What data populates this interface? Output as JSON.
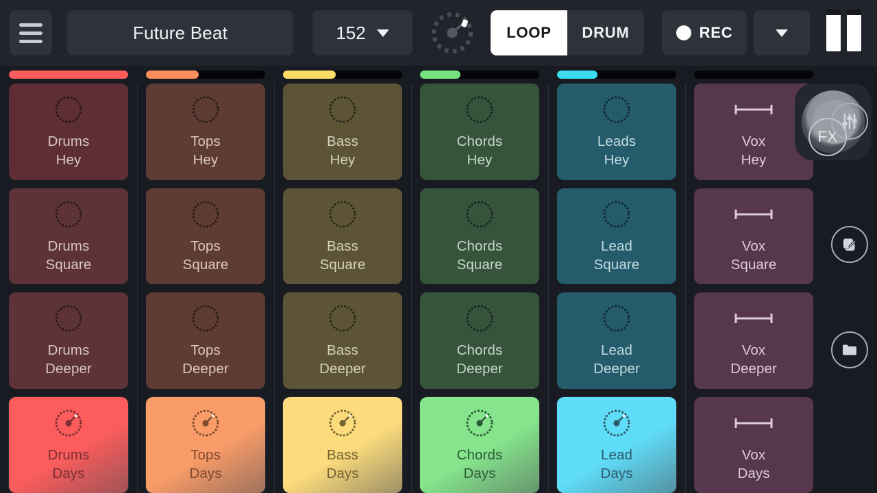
{
  "header": {
    "menu_icon": "hamburger-menu-icon",
    "project_name": "Future Beat",
    "tempo": "152",
    "tempo_caret_icon": "chevron-down-icon",
    "metronome_icon": "metronome-dial-icon",
    "mode_loop": "LOOP",
    "mode_drum": "DRUM",
    "active_mode": "LOOP",
    "rec_label": "REC",
    "rec_dot_icon": "record-dot-icon",
    "rec_options_caret_icon": "chevron-down-icon",
    "transport_icon": "pause-icon"
  },
  "colors": {
    "app_background": "#191b22",
    "header_background": "#22242c",
    "button_background": "#2f323b",
    "text_primary": "#f0f1f3",
    "accent_white": "#ffffff",
    "divider": "#2c2f38",
    "track_empty": "#050507"
  },
  "tracks": [
    {
      "name": "Drums",
      "color": "#fc5c5c",
      "progress_percent": 100
    },
    {
      "name": "Tops",
      "color": "#fa8f5e",
      "progress_percent": 44
    },
    {
      "name": "Bass",
      "color": "#fbdb64",
      "progress_percent": 44
    },
    {
      "name": "Chords",
      "color": "#74e281",
      "progress_percent": 34
    },
    {
      "name": "Leads",
      "color": "#3ddbf0",
      "progress_percent": 34
    },
    {
      "name": "Vox",
      "color": "#b77ab0",
      "progress_percent": 0
    }
  ],
  "grid": {
    "columns": [
      {
        "track": "Drums",
        "cells": [
          {
            "track_label": "Drums",
            "clip_label": "Hey",
            "state": "idle",
            "icon": "loop-circle-icon",
            "bg": "#5d2f34",
            "text": "#d8c5c5"
          },
          {
            "track_label": "Drums",
            "clip_label": "Square",
            "state": "idle",
            "icon": "loop-circle-icon",
            "bg": "#5d3338",
            "text": "#d8c5c5"
          },
          {
            "track_label": "Drums",
            "clip_label": "Deeper",
            "state": "idle",
            "icon": "loop-circle-icon",
            "bg": "#5d3338",
            "text": "#d8c5c5"
          },
          {
            "track_label": "Drums",
            "clip_label": "Days",
            "state": "playing",
            "icon": "playhead-dial-icon",
            "bg": "#fc5c5c",
            "text": "#7b2f34"
          }
        ]
      },
      {
        "track": "Tops",
        "cells": [
          {
            "track_label": "Tops",
            "clip_label": "Hey",
            "state": "idle",
            "icon": "loop-circle-icon",
            "bg": "#5f3c33",
            "text": "#dbc8bf"
          },
          {
            "track_label": "Tops",
            "clip_label": "Square",
            "state": "idle",
            "icon": "loop-circle-icon",
            "bg": "#5f3c33",
            "text": "#dbc8bf"
          },
          {
            "track_label": "Tops",
            "clip_label": "Deeper",
            "state": "idle",
            "icon": "loop-circle-icon",
            "bg": "#5f3c33",
            "text": "#dbc8bf"
          },
          {
            "track_label": "Tops",
            "clip_label": "Days",
            "state": "playing",
            "icon": "playhead-dial-icon",
            "bg": "#fa9c68",
            "text": "#7b4a30"
          }
        ]
      },
      {
        "track": "Bass",
        "cells": [
          {
            "track_label": "Bass",
            "clip_label": "Hey",
            "state": "idle",
            "icon": "loop-circle-icon",
            "bg": "#5d5435",
            "text": "#d6d2bd"
          },
          {
            "track_label": "Bass",
            "clip_label": "Square",
            "state": "idle",
            "icon": "loop-circle-icon",
            "bg": "#5d5435",
            "text": "#d6d2bd"
          },
          {
            "track_label": "Bass",
            "clip_label": "Deeper",
            "state": "idle",
            "icon": "loop-circle-icon",
            "bg": "#5d5435",
            "text": "#d6d2bd"
          },
          {
            "track_label": "Bass",
            "clip_label": "Days",
            "state": "playing",
            "icon": "playhead-dial-icon",
            "bg": "#fbdb7c",
            "text": "#746233"
          }
        ]
      },
      {
        "track": "Chords",
        "cells": [
          {
            "track_label": "Chords",
            "clip_label": "Hey",
            "state": "idle",
            "icon": "loop-circle-icon",
            "bg": "#36543c",
            "text": "#c6d6c7"
          },
          {
            "track_label": "Chords",
            "clip_label": "Square",
            "state": "idle",
            "icon": "loop-circle-icon",
            "bg": "#36543c",
            "text": "#c6d6c7"
          },
          {
            "track_label": "Chords",
            "clip_label": "Deeper",
            "state": "idle",
            "icon": "loop-circle-icon",
            "bg": "#36543c",
            "text": "#c6d6c7"
          },
          {
            "track_label": "Chords",
            "clip_label": "Days",
            "state": "playing",
            "icon": "playhead-dial-icon",
            "bg": "#85e48c",
            "text": "#2f5c38"
          }
        ]
      },
      {
        "track": "Leads",
        "cells": [
          {
            "track_label": "Leads",
            "clip_label": "Hey",
            "state": "idle",
            "icon": "loop-circle-icon",
            "bg": "#255c6b",
            "text": "#c3dbe2"
          },
          {
            "track_label": "Lead",
            "clip_label": "Square",
            "state": "idle",
            "icon": "loop-circle-icon",
            "bg": "#255c6b",
            "text": "#c3dbe2"
          },
          {
            "track_label": "Lead",
            "clip_label": "Deeper",
            "state": "idle",
            "icon": "loop-circle-icon",
            "bg": "#255c6b",
            "text": "#c3dbe2"
          },
          {
            "track_label": "Lead",
            "clip_label": "Days",
            "state": "playing",
            "icon": "playhead-dial-icon",
            "bg": "#5fdcf8",
            "text": "#2b5a68"
          }
        ]
      },
      {
        "track": "Vox",
        "cells": [
          {
            "track_label": "Vox",
            "clip_label": "Hey",
            "state": "empty",
            "icon": "waveform-bar-icon",
            "bg": "#56374d",
            "text": "#ddcdd8"
          },
          {
            "track_label": "Vox",
            "clip_label": "Square",
            "state": "empty",
            "icon": "waveform-bar-icon",
            "bg": "#56374d",
            "text": "#ddcdd8"
          },
          {
            "track_label": "Vox",
            "clip_label": "Deeper",
            "state": "empty",
            "icon": "waveform-bar-icon",
            "bg": "#56374d",
            "text": "#ddcdd8"
          },
          {
            "track_label": "Vox",
            "clip_label": "Days",
            "state": "empty",
            "icon": "waveform-bar-icon",
            "bg": "#56374d",
            "text": "#ddcdd8"
          }
        ]
      }
    ]
  },
  "sidebar": {
    "mixer_icon": "mixer-faders-icon",
    "fx_label": "FX",
    "fx_knob_icon": "fx-knob-icon",
    "edit_icon": "edit-pencil-icon",
    "folder_icon": "folder-icon"
  }
}
